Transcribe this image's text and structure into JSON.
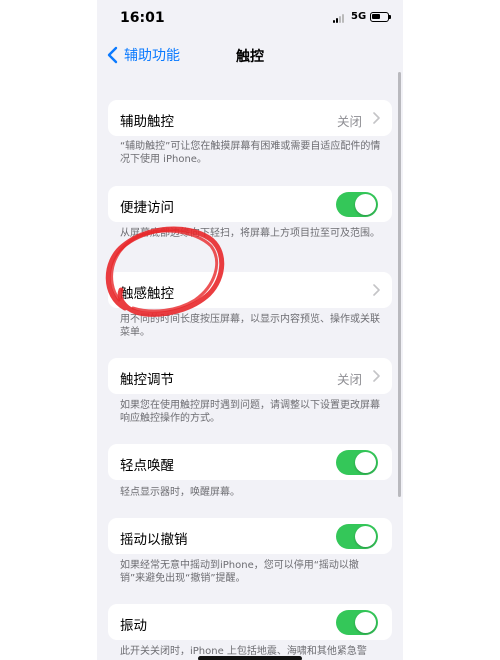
{
  "status_bar": {
    "time": "16:01",
    "network": "5G"
  },
  "nav": {
    "back_label": "辅助功能",
    "title": "触控"
  },
  "sections": {
    "assistive_touch": {
      "label": "辅助触控",
      "value": "关闭",
      "footer": "“辅助触控”可让您在触摸屏幕有困难或需要自适应配件的情况下使用 iPhone。"
    },
    "reachability": {
      "label": "便捷访问",
      "toggle": true,
      "footer": "从屏幕底部边缘向下轻扫，将屏幕上方项目拉至可及范围。"
    },
    "haptic_touch": {
      "label": "触感触控",
      "footer": "用不同的时间长度按压屏幕，以显示内容预览、操作或关联菜单。"
    },
    "touch_accommodations": {
      "label": "触控调节",
      "value": "关闭",
      "footer": "如果您在使用触控屏时遇到问题，请调整以下设置更改屏幕响应触控操作的方式。"
    },
    "tap_to_wake": {
      "label": "轻点唤醒",
      "toggle": true,
      "footer": "轻点显示器时，唤醒屏幕。"
    },
    "shake_to_undo": {
      "label": "摇动以撤销",
      "toggle": true,
      "footer": "如果经常无意中摇动到iPhone，您可以停用“摇动以撤销”来避免出现“撤销”提醒。"
    },
    "vibration": {
      "label": "振动",
      "toggle": true,
      "footer": "此开关关闭时，iPhone 上包括地震、海啸和其他紧急警"
    }
  },
  "colors": {
    "accent": "#0a7aff",
    "toggle_on": "#34c759",
    "annotation": "#e8282b",
    "background": "#f2f2f7"
  }
}
